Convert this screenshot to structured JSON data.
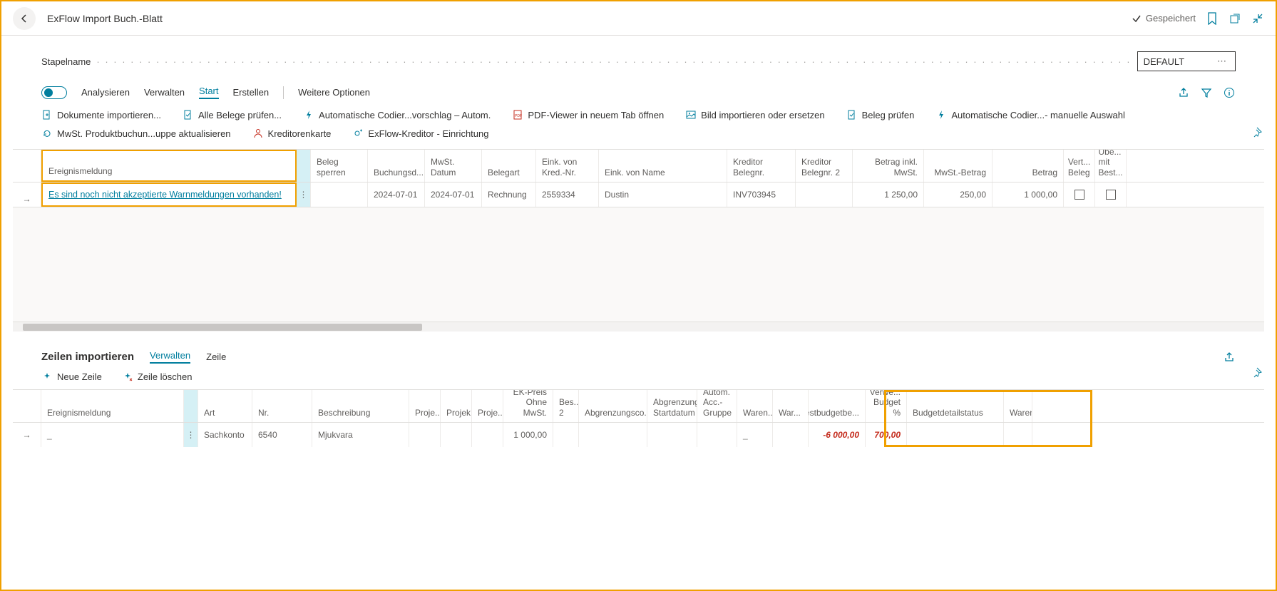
{
  "header": {
    "page_title": "ExFlow Import Buch.-Blatt",
    "saved_label": "Gespeichert"
  },
  "batch": {
    "label": "Stapelname",
    "value": "DEFAULT"
  },
  "tabs": {
    "analyze": "Analysieren",
    "manage": "Verwalten",
    "start": "Start",
    "create": "Erstellen",
    "more": "Weitere Optionen"
  },
  "actions": {
    "import_docs": "Dokumente importieren...",
    "check_all": "Alle Belege prüfen...",
    "auto_coding_sugg": "Automatische Codier...vorschlag – Autom.",
    "pdf_viewer": "PDF-Viewer in neuem Tab öffnen",
    "import_image": "Bild importieren oder ersetzen",
    "check_doc": "Beleg prüfen",
    "auto_coding_manual": "Automatische Codier...- manuelle Auswahl",
    "vat_group": "MwSt. Produktbuchun...uppe aktualisieren",
    "vendor_card": "Kreditorenkarte",
    "exflow_vendor": "ExFlow-Kreditor - Einrichtung"
  },
  "table1": {
    "cols": {
      "event": "Ereignismeldung",
      "beleg_sperren": "Beleg sperren",
      "buchungsd": "Buchungsd...",
      "mwst_datum": "MwSt. Datum",
      "belegart": "Belegart",
      "eink_nr": "Eink. von Kred.-Nr.",
      "eink_name": "Eink. von Name",
      "kred_beleg": "Kreditor Belegnr.",
      "kred_beleg2": "Kreditor Belegnr. 2",
      "betrag_mwst": "Betrag inkl. MwSt.",
      "mwst_betrag": "MwSt.-Betrag",
      "betrag": "Betrag",
      "vert_beleg": "Vert... Beleg",
      "uebe_best": "Übe... mit Best..."
    },
    "row": {
      "event_link": "Es sind noch nicht akzeptierte Warnmeldungen vorhanden!",
      "buchungsd": "2024-07-01",
      "mwst_datum": "2024-07-01",
      "belegart": "Rechnung",
      "eink_nr": "2559334",
      "eink_name": "Dustin",
      "kred_beleg": "INV703945",
      "betrag_mwst": "1 250,00",
      "mwst_betrag": "250,00",
      "betrag": "1 000,00"
    }
  },
  "section2": {
    "title": "Zeilen importieren",
    "tab_manage": "Verwalten",
    "tab_line": "Zeile",
    "new_line": "Neue Zeile",
    "delete_line": "Zeile löschen"
  },
  "table2": {
    "cols": {
      "event": "Ereignismeldung",
      "art": "Art",
      "nr": "Nr.",
      "besch": "Beschreibung",
      "proj1": "Proje...",
      "proj2": "Projek...",
      "proj3": "Proje...",
      "ek": "EK-Preis Ohne MwSt.",
      "bes2": "Bes... 2",
      "abgr": "Abgrenzungsco...",
      "abst": "Abgrenzung Startdatum",
      "auto": "Autom. Acc.-Gruppe",
      "war1": "Waren...",
      "war2": "War...",
      "rest": "Restbudgetbe...",
      "verw": "Verwe... Budget %",
      "buds": "Budgetdetailstatus",
      "war3": "Waren..."
    },
    "row": {
      "event": "_",
      "art": "Sachkonto",
      "nr": "6540",
      "besch": "Mjukvara",
      "ek": "1 000,00",
      "war1": "_",
      "rest": "-6 000,00",
      "verw": "700,00"
    }
  }
}
